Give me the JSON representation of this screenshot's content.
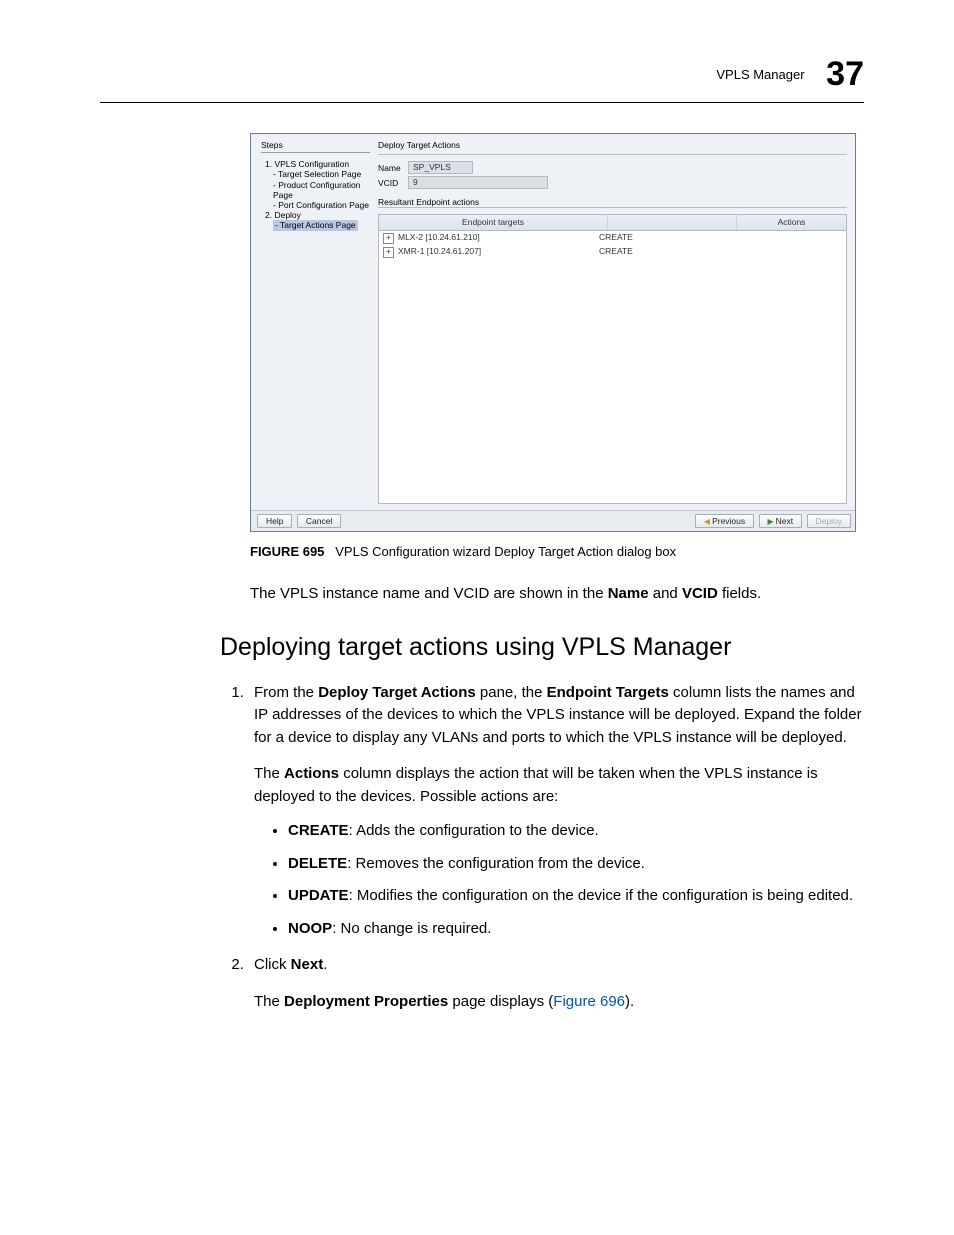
{
  "header": {
    "chapter_title": "VPLS Manager",
    "chapter_number": "37"
  },
  "dialog": {
    "steps_label": "Steps",
    "steps": {
      "s1": "1. VPLS Configuration",
      "s1a": "- Target Selection Page",
      "s1b": "- Product Configuration Page",
      "s1c": "- Port Configuration Page",
      "s2": "2. Deploy",
      "s2a": "- Target Actions Page"
    },
    "main_title": "Deploy Target Actions",
    "name_label": "Name",
    "name_value": "SP_VPLS",
    "vcid_label": "VCID",
    "vcid_value": "9",
    "subheader": "Resultant Endpoint actions",
    "cols": {
      "a": "Endpoint targets",
      "b": "",
      "c": "Actions"
    },
    "rows": [
      {
        "name": "MLX-2 [10.24.61.210]",
        "action": "CREATE"
      },
      {
        "name": "XMR-1 [10.24.61.207]",
        "action": "CREATE"
      }
    ],
    "buttons": {
      "help": "Help",
      "cancel": "Cancel",
      "previous": "Previous",
      "next": "Next",
      "deploy": "Deploy"
    }
  },
  "caption": {
    "label": "FIGURE 695",
    "text": "VPLS Configuration wizard Deploy Target Action dialog box"
  },
  "para1": {
    "pre": "The VPLS instance name and VCID are shown in the ",
    "b1": "Name",
    "mid": " and ",
    "b2": "VCID",
    "post": " fields."
  },
  "h2": "Deploying target actions using VPLS Manager",
  "step1": {
    "a": "From the ",
    "b1": "Deploy Target Actions",
    "c": " pane, the ",
    "b2": "Endpoint Targets",
    "d": " column lists the names and IP addresses of the devices to which the VPLS instance will be deployed. Expand the folder for a device to display any VLANs and ports to which the VPLS instance will be deployed.",
    "p2a": "The ",
    "p2b": "Actions",
    "p2c": " column displays the action that will be taken when the VPLS instance is deployed to the devices. Possible actions are:"
  },
  "actions": {
    "create_b": "CREATE",
    "create_t": ": Adds the configuration to the device.",
    "delete_b": "DELETE",
    "delete_t": ": Removes the configuration from the device.",
    "update_b": "UPDATE",
    "update_t": ": Modifies the configuration on the device if the configuration is being edited.",
    "noop_b": "NOOP",
    "noop_t": ": No change is required."
  },
  "step2": {
    "a": "Click ",
    "b": "Next",
    "c": ".",
    "p2a": "The ",
    "p2b": "Deployment Properties",
    "p2c": " page displays (",
    "link": "Figure 696",
    "p2d": ")."
  }
}
